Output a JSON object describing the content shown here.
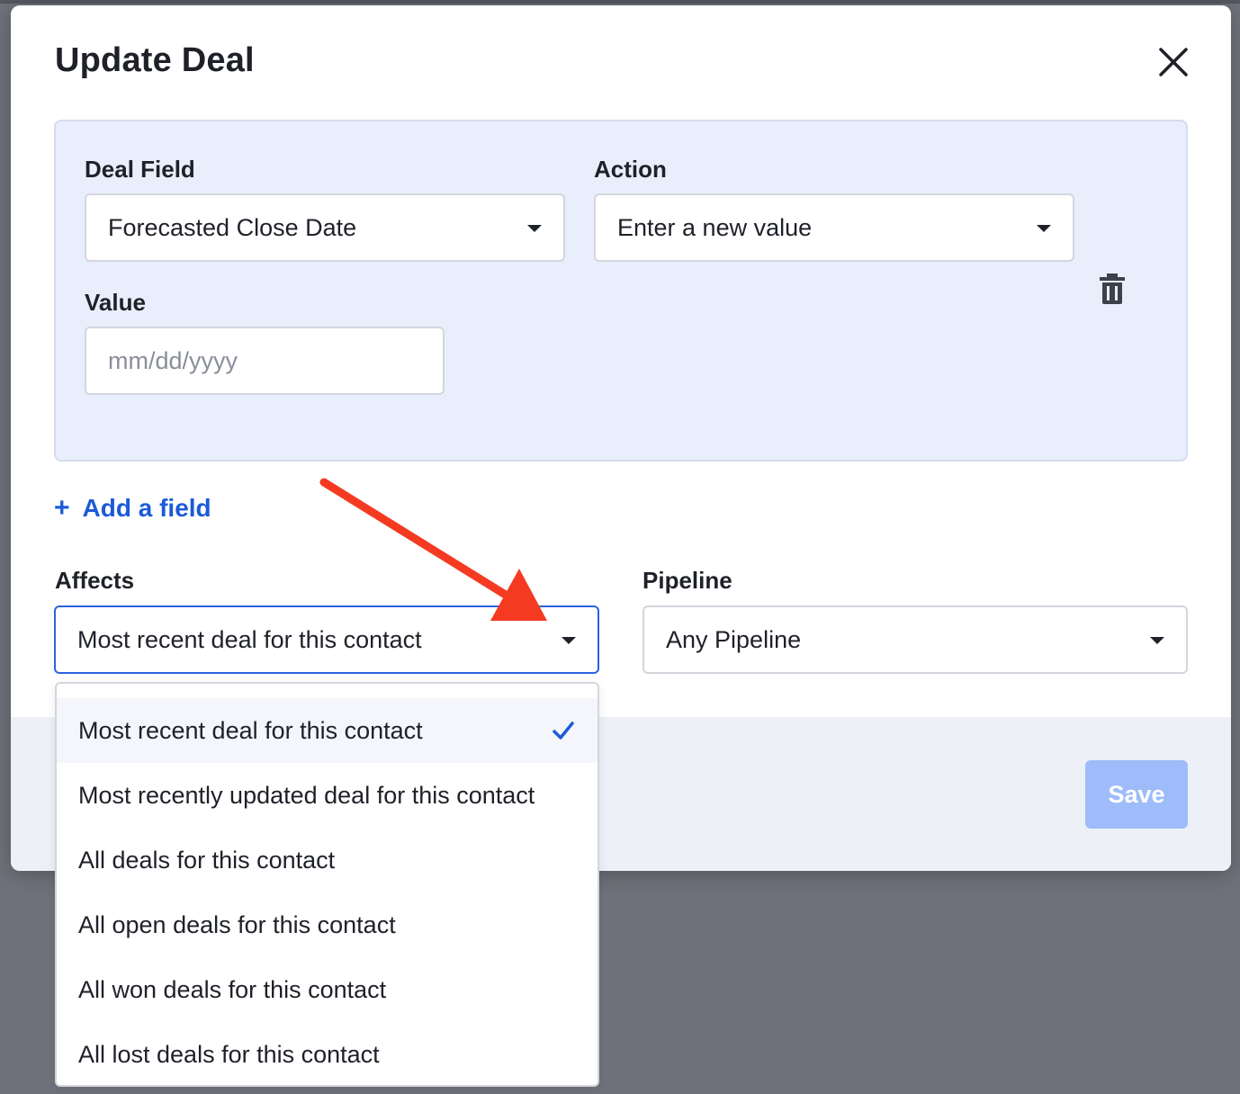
{
  "modal": {
    "title": "Update Deal",
    "close_icon": "close-icon"
  },
  "field_card": {
    "deal_field_label": "Deal Field",
    "deal_field_value": "Forecasted Close Date",
    "action_label": "Action",
    "action_value": "Enter a new value",
    "value_label": "Value",
    "value_placeholder": "mm/dd/yyyy",
    "delete_icon": "trash-icon"
  },
  "add_field": {
    "plus": "+",
    "label": "Add a field"
  },
  "affects": {
    "label": "Affects",
    "value": "Most recent deal for this contact",
    "options": [
      {
        "label": "Most recent deal for this contact",
        "selected": true
      },
      {
        "label": "Most recently updated deal for this contact",
        "selected": false
      },
      {
        "label": "All deals for this contact",
        "selected": false
      },
      {
        "label": "All open deals for this contact",
        "selected": false
      },
      {
        "label": "All won deals for this contact",
        "selected": false
      },
      {
        "label": "All lost deals for this contact",
        "selected": false
      }
    ]
  },
  "pipeline": {
    "label": "Pipeline",
    "value": "Any Pipeline"
  },
  "footer": {
    "save_label": "Save"
  },
  "colors": {
    "accent": "#1d5ad8",
    "card_background": "#e9eefc",
    "save_disabled": "#9dbcf9",
    "annotation_arrow": "#f43b22"
  }
}
